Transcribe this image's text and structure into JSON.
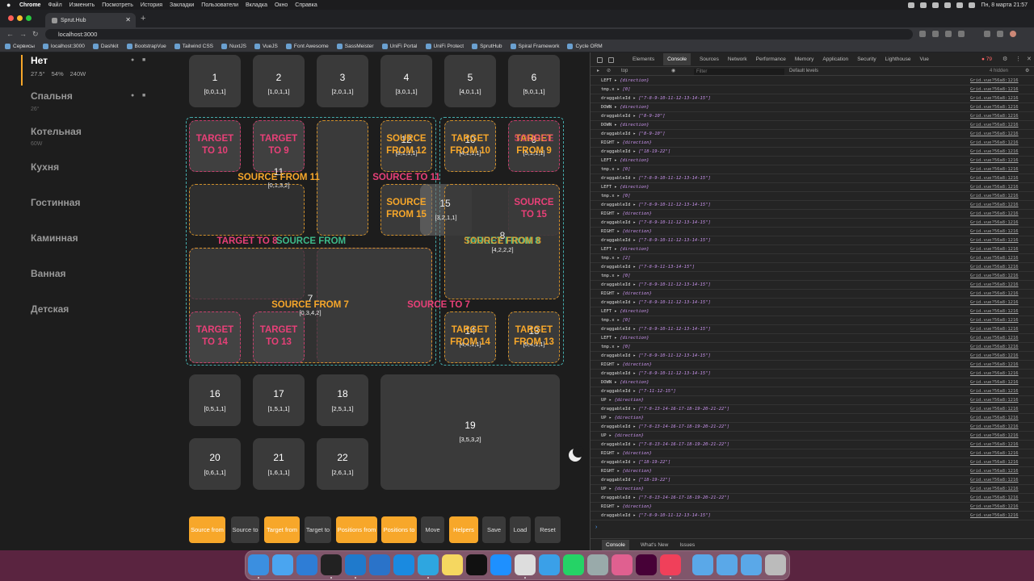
{
  "menubar": {
    "app": "Chrome",
    "items": [
      "Файл",
      "Изменить",
      "Посмотреть",
      "История",
      "Закладки",
      "Пользователи",
      "Вкладка",
      "Окно",
      "Справка"
    ],
    "clock": "Пн, 8 марта  21:57"
  },
  "browser": {
    "tab_title": "Sprut.Hub",
    "url": "localhost:3000",
    "bookmarks": [
      "Сервисы",
      "localhost:3000",
      "Dashkit",
      "BootstrapVue",
      "Tailwind CSS",
      "NuxtJS",
      "VueJS",
      "Font Awesome",
      "SassMeister",
      "UniFi Portal",
      "UniFi Protect",
      "SprutHub",
      "Spiral Framework",
      "Cycle ORM"
    ]
  },
  "sidebar": {
    "rooms": [
      {
        "name": "Нет",
        "active": true
      },
      {
        "name": "Спальня",
        "sub": "26°"
      },
      {
        "name": "Котельная",
        "sub": "60W"
      },
      {
        "name": "Кухня"
      },
      {
        "name": "Гостинная"
      },
      {
        "name": "Каминная"
      },
      {
        "name": "Ванная"
      },
      {
        "name": "Детская"
      }
    ],
    "stats": {
      "temp": "27.5°",
      "humidity": "54%",
      "power": "240W"
    }
  },
  "tiles": [
    {
      "n": "1",
      "c": "[0,0,1,1]"
    },
    {
      "n": "2",
      "c": "[1,0,1,1]"
    },
    {
      "n": "3",
      "c": "[2,0,1,1]"
    },
    {
      "n": "4",
      "c": "[3,0,1,1]"
    },
    {
      "n": "5",
      "c": "[4,0,1,1]"
    },
    {
      "n": "6",
      "c": "[5,0,1,1]"
    },
    {
      "n": "16",
      "c": "[0,5,1,1]"
    },
    {
      "n": "17",
      "c": "[1,5,1,1]"
    },
    {
      "n": "18",
      "c": "[2,5,1,1]"
    },
    {
      "n": "19",
      "c": "[3,5,3,2]"
    },
    {
      "n": "20",
      "c": "[0,6,1,1]"
    },
    {
      "n": "21",
      "c": "[1,6,1,1]"
    },
    {
      "n": "22",
      "c": "[2,6,1,1]"
    }
  ],
  "grid_items": [
    {
      "n": "11",
      "c": "[0,1,3,2]"
    },
    {
      "n": "15",
      "c": "[3,2,1,1]"
    },
    {
      "n": "8",
      "c": "[4,2,2,2]"
    },
    {
      "n": "7",
      "c": "[0,3,4,2]"
    },
    {
      "n": "12",
      "c": "[3,1,1,1]"
    },
    {
      "n": "10",
      "c": "[4,1,1,1]"
    },
    {
      "n": "9",
      "c": "[5,1,1,1]"
    },
    {
      "n": "14",
      "c": "[4,4,1,1]"
    },
    {
      "n": "13",
      "c": "[5,4,1,1]"
    }
  ],
  "labels": {
    "t10": "TARGET TO 10",
    "t9": "TARGET TO 9",
    "s12": "SOURCE FROM 12",
    "f10": "TARGET FROM 10",
    "f9": "TARGET FROM 9",
    "s9": "SOURCE",
    "s11": "SOURCE FROM 11",
    "st11": "SOURCE TO 11",
    "s15": "SOURCE FROM 15",
    "st15": "SOURCE TO 15",
    "t8": "TARGET TO 8",
    "sf": "SOURCE FROM",
    "tf8": "TARGET FROM 8",
    "sf8": "SOURCE FROM 8",
    "s7": "SOURCE FROM 7",
    "st7": "SOURCE TO 7",
    "t14": "TARGET TO 14",
    "t13": "TARGET TO 13",
    "f14": "TARGET FROM 14",
    "f13": "TARGET FROM 13"
  },
  "buttons": [
    {
      "l": "Source from",
      "on": true
    },
    {
      "l": "Source to",
      "on": false
    },
    {
      "l": "Target from",
      "on": true
    },
    {
      "l": "Target to",
      "on": false
    },
    {
      "l": "Positions from",
      "on": true
    },
    {
      "l": "Positions to",
      "on": true
    },
    {
      "l": "Move",
      "on": false
    },
    {
      "l": "Helpers",
      "on": true
    },
    {
      "l": "Save",
      "on": false
    },
    {
      "l": "Load",
      "on": false
    },
    {
      "l": "Reset",
      "on": false
    }
  ],
  "devtools": {
    "tabs": [
      "Elements",
      "Console",
      "Sources",
      "Network",
      "Performance",
      "Memory",
      "Application",
      "Security",
      "Lighthouse",
      "Vue"
    ],
    "active": "Console",
    "errors": "79",
    "context": "top",
    "filter_placeholder": "Filter",
    "levels": "Default levels",
    "hidden": "4 hidden",
    "bottom_tabs": [
      "Console",
      "What's New",
      "Issues"
    ],
    "src": "Grid.vue?56a8:1216",
    "logs": [
      [
        "LEFT",
        "{direction}"
      ],
      [
        "tmp.x",
        "[0]"
      ],
      [
        "draggableId",
        "[\"7-8-9-10-11-12-13-14-15\"]"
      ],
      [
        "DOWN",
        "{direction}"
      ],
      [
        "draggableId",
        "[\"8-9-10\"]"
      ],
      [
        "DOWN",
        "{direction}"
      ],
      [
        "draggableId",
        "[\"8-9-10\"]"
      ],
      [
        "RIGHT",
        "{direction}"
      ],
      [
        "draggableId",
        "[\"18-19-22\"]"
      ],
      [
        "LEFT",
        "{direction}"
      ],
      [
        "tmp.x",
        "[0]"
      ],
      [
        "draggableId",
        "[\"7-8-9-10-11-12-13-14-15\"]"
      ],
      [
        "LEFT",
        "{direction}"
      ],
      [
        "tmp.x",
        "[0]"
      ],
      [
        "draggableId",
        "[\"7-8-9-10-11-12-13-14-15\"]"
      ],
      [
        "RIGHT",
        "{direction}"
      ],
      [
        "draggableId",
        "[\"7-8-9-10-11-12-13-14-15\"]"
      ],
      [
        "RIGHT",
        "{direction}"
      ],
      [
        "draggableId",
        "[\"7-8-9-10-11-12-13-14-15\"]"
      ],
      [
        "LEFT",
        "{direction}"
      ],
      [
        "tmp.x",
        "[2]"
      ],
      [
        "draggableId",
        "[\"7-8-9-11-13-14-15\"]"
      ],
      [
        "tmp.x",
        "[0]"
      ],
      [
        "draggableId",
        "[\"7-8-9-10-11-12-13-14-15\"]"
      ],
      [
        "RIGHT",
        "{direction}"
      ],
      [
        "draggableId",
        "[\"7-8-9-10-11-12-13-14-15\"]"
      ],
      [
        "LEFT",
        "{direction}"
      ],
      [
        "tmp.x",
        "[0]"
      ],
      [
        "draggableId",
        "[\"7-8-9-10-11-12-13-14-15\"]"
      ],
      [
        "LEFT",
        "{direction}"
      ],
      [
        "tmp.x",
        "[0]"
      ],
      [
        "draggableId",
        "[\"7-8-9-10-11-12-13-14-15\"]"
      ],
      [
        "RIGHT",
        "{direction}"
      ],
      [
        "draggableId",
        "[\"7-8-9-10-11-12-13-14-15\"]"
      ],
      [
        "DOWN",
        "{direction}"
      ],
      [
        "draggableId",
        "[\"7-11-12-15\"]"
      ],
      [
        "UP",
        "{direction}"
      ],
      [
        "draggableId",
        "[\"7-8-13-14-16-17-18-19-20-21-22\"]"
      ],
      [
        "UP",
        "{direction}"
      ],
      [
        "draggableId",
        "[\"7-8-13-14-16-17-18-19-20-21-22\"]"
      ],
      [
        "UP",
        "{direction}"
      ],
      [
        "draggableId",
        "[\"7-8-13-14-16-17-18-19-20-21-22\"]"
      ],
      [
        "RIGHT",
        "{direction}"
      ],
      [
        "draggableId",
        "[\"18-19-22\"]"
      ],
      [
        "RIGHT",
        "{direction}"
      ],
      [
        "draggableId",
        "[\"18-19-22\"]"
      ],
      [
        "UP",
        "{direction}"
      ],
      [
        "draggableId",
        "[\"7-8-13-14-16-17-18-19-20-21-22\"]"
      ],
      [
        "RIGHT",
        "{direction}"
      ],
      [
        "draggableId",
        "[\"7-8-9-10-11-12-13-14-15\"]"
      ]
    ]
  }
}
